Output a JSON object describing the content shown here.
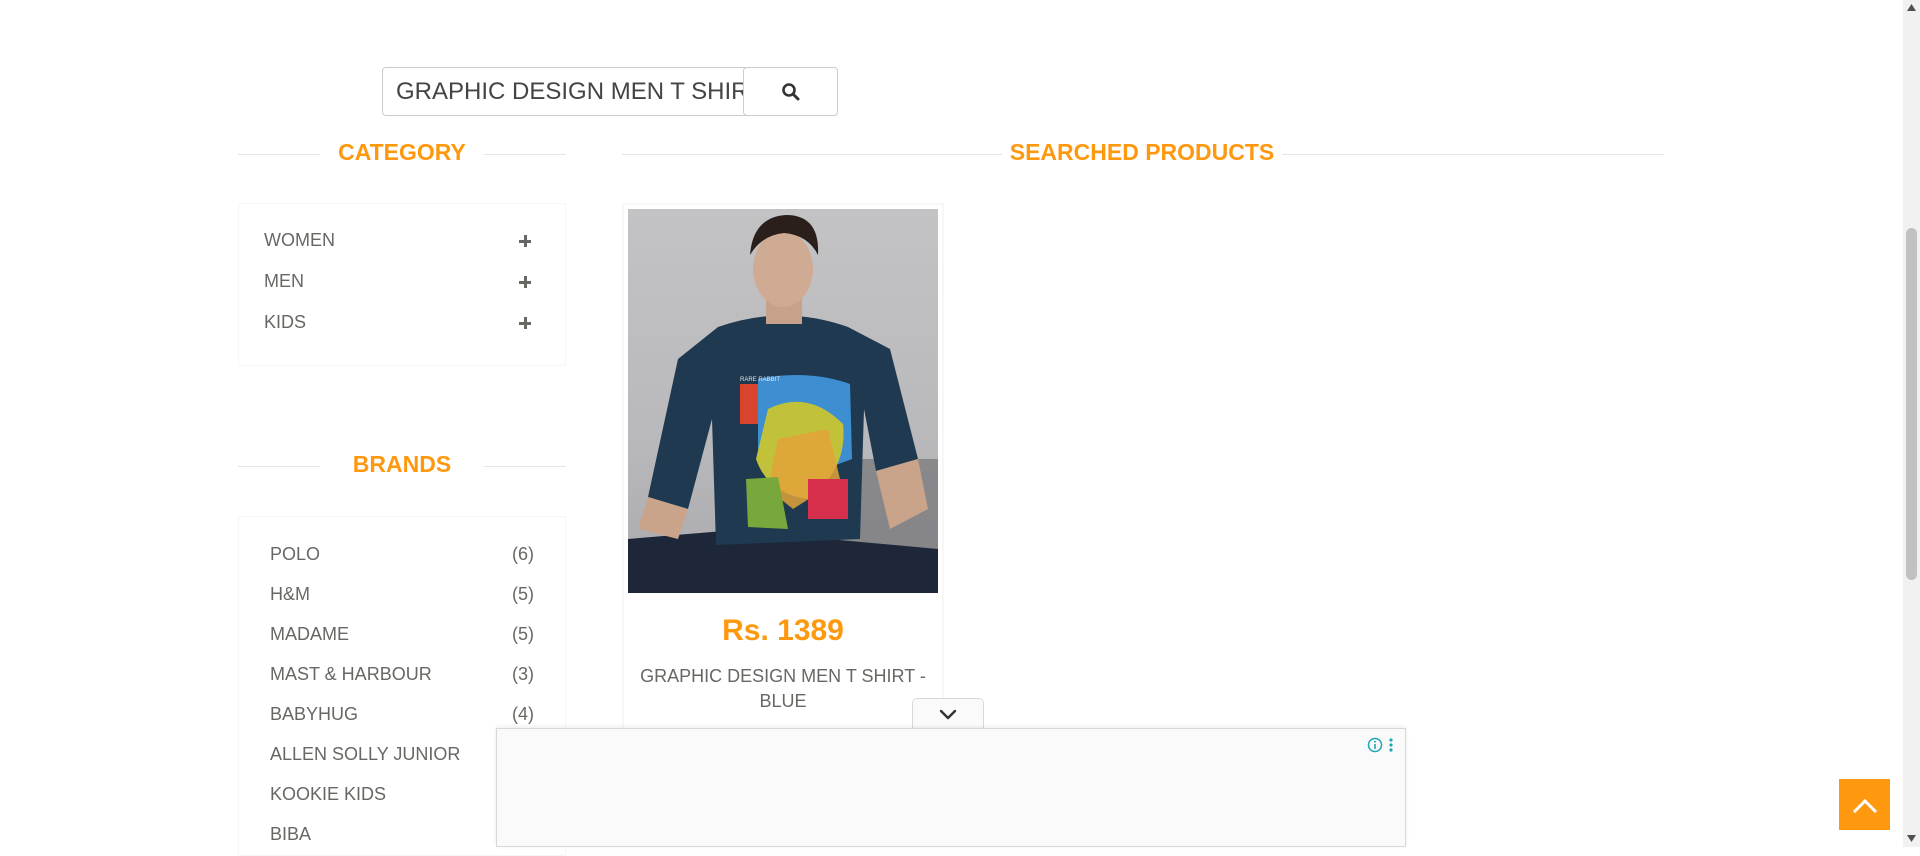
{
  "search": {
    "value": "GRAPHIC DESIGN MEN T SHIRT",
    "button_icon": "search-icon"
  },
  "category": {
    "title": "CATEGORY",
    "items": [
      {
        "label": "WOMEN",
        "icon": "plus-icon"
      },
      {
        "label": "MEN",
        "icon": "plus-icon"
      },
      {
        "label": "KIDS",
        "icon": "plus-icon"
      }
    ]
  },
  "brands": {
    "title": "BRANDS",
    "items": [
      {
        "name": "POLO",
        "count": "(6)"
      },
      {
        "name": "H&M",
        "count": "(5)"
      },
      {
        "name": "MADAME",
        "count": "(5)"
      },
      {
        "name": "MAST & HARBOUR",
        "count": "(3)"
      },
      {
        "name": "BABYHUG",
        "count": "(4)"
      },
      {
        "name": "ALLEN SOLLY JUNIOR",
        "count": ""
      },
      {
        "name": "KOOKIE KIDS",
        "count": ""
      },
      {
        "name": "BIBA",
        "count": ""
      }
    ]
  },
  "results": {
    "title": "SEARCHED PRODUCTS",
    "products": [
      {
        "price": "Rs. 1389",
        "name": "GRAPHIC DESIGN MEN T SHIRT - BLUE",
        "image_text": "RARE RABBIT"
      }
    ]
  },
  "ad": {
    "collapse_icon": "chevron-down-icon",
    "info_icon": "info-icon",
    "menu_icon": "more-vertical-icon"
  },
  "scroll_up_icon": "chevron-up-icon",
  "colors": {
    "accent": "#fe980f",
    "text": "#696763"
  }
}
